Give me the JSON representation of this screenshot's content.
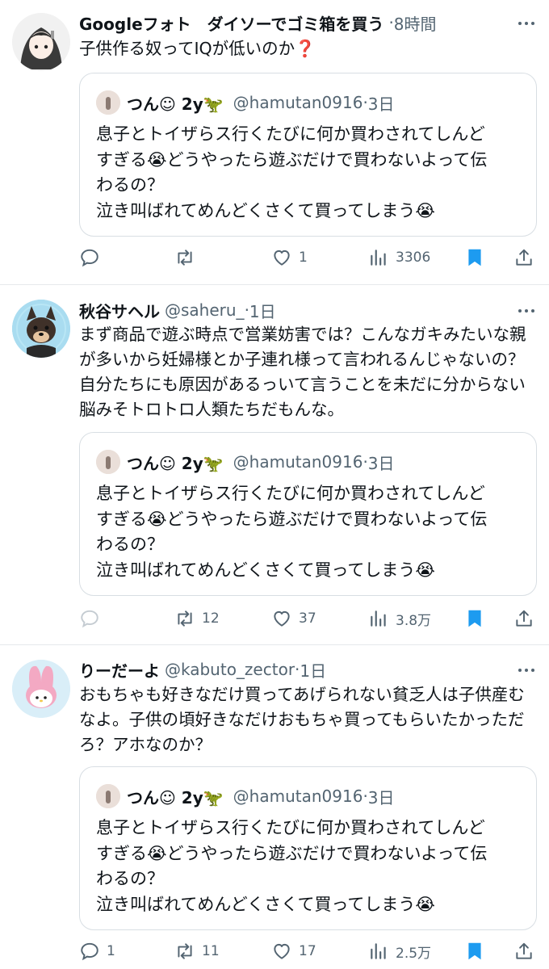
{
  "quoted": {
    "name": "つん☺︎ 2y🦖",
    "handle": "@hamutan0916",
    "dot": "·",
    "time": "3日",
    "lines": [
      "息子とトイザらス行くたびに何か買わされてしんど",
      "すぎる😭どうやったら遊ぶだけで買わないよって伝",
      "わるの？",
      "泣き叫ばれてめんどくさくて買ってしまう😭"
    ]
  },
  "tweets": [
    {
      "author": "Googleフォト　ダイソーでゴミ箱を買う",
      "handle": "",
      "dot": "·",
      "time": "8時間",
      "text": "子供作る奴ってIQが低いのか❓",
      "reply_count": "",
      "retweet_count": "",
      "like_count": "1",
      "view_count": "3306"
    },
    {
      "author": "秋谷サヘル",
      "handle": "@saheru_",
      "dot": "·",
      "time": "1日",
      "text": "まず商品で遊ぶ時点で営業妨害では？こんなガキみたいな親が多いから妊婦様とか子連れ様って言われるんじゃないの？自分たちにも原因があるっいて言うことを未だに分からない脳みそトロトロ人類たちだもんな。",
      "reply_count": "",
      "retweet_count": "12",
      "like_count": "37",
      "view_count": "3.8万"
    },
    {
      "author": "りーだーよ",
      "handle": "@kabuto_zector",
      "dot": "·",
      "time": "1日",
      "text": "おもちゃも好きなだけ買ってあげられない貧乏人は子供産むなよ。子供の頃好きなだけおもちゃ買ってもらいたかっただろ？アホなのか？",
      "reply_count": "1",
      "retweet_count": "11",
      "like_count": "17",
      "view_count": "2.5万"
    }
  ],
  "colors": {
    "text": "#0f1419",
    "secondary": "#536471",
    "bookmark_active": "#1d9bf0",
    "divider": "#e6e9ec",
    "red_question": "#e0245e"
  },
  "icons": [
    "reply-icon",
    "retweet-icon",
    "like-icon",
    "views-icon",
    "bookmark-icon",
    "share-icon",
    "more-icon"
  ]
}
